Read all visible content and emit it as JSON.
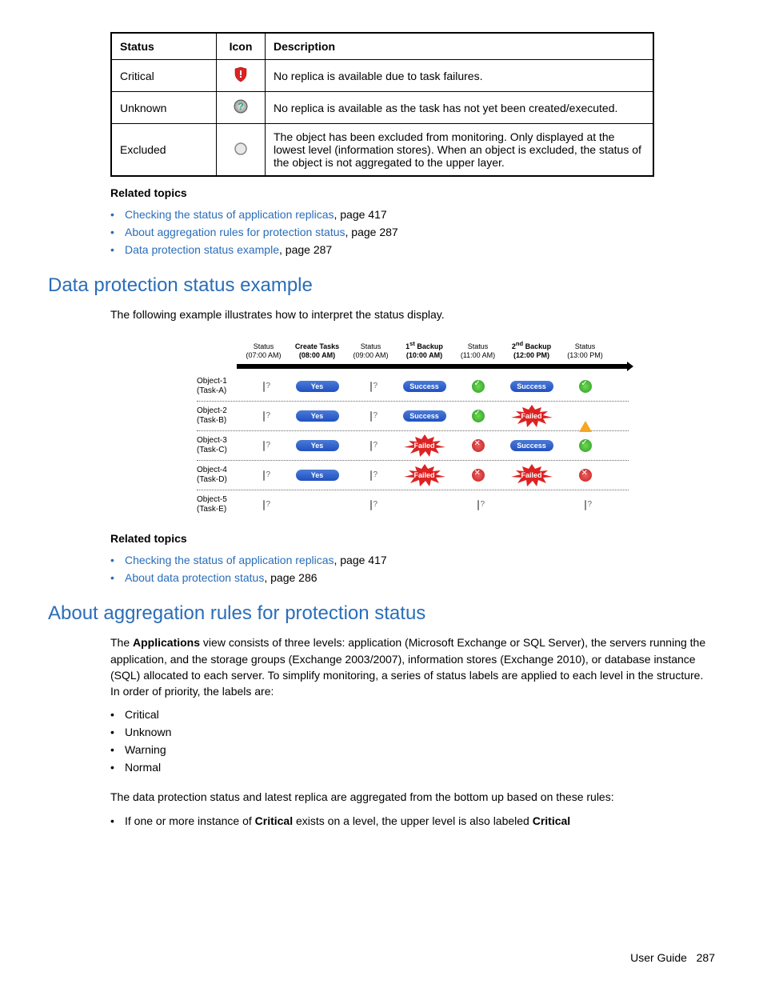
{
  "statusTable": {
    "headers": [
      "Status",
      "Icon",
      "Description"
    ],
    "rows": [
      {
        "status": "Critical",
        "icon": "critical-shield-icon",
        "desc": "No replica is available due to task failures."
      },
      {
        "status": "Unknown",
        "icon": "unknown-question-icon",
        "desc": "No replica is available as the task has not yet been created/executed."
      },
      {
        "status": "Excluded",
        "icon": "excluded-circle-icon",
        "desc": "The object has been excluded from monitoring. Only displayed at the lowest level (information stores). When an object is excluded, the status of the object is not aggregated to the upper layer."
      }
    ]
  },
  "related1": {
    "heading": "Related topics",
    "items": [
      {
        "link": "Checking the status of application replicas",
        "suffix": ", page 417"
      },
      {
        "link": "About aggregation rules for protection status",
        "suffix": ", page 287"
      },
      {
        "link": "Data protection status example",
        "suffix": ", page 287"
      }
    ]
  },
  "section1": {
    "title": "Data protection status example",
    "intro": "The following example illustrates how to interpret the status display."
  },
  "diagram": {
    "columns": [
      {
        "l1": "Status",
        "l2": "(07:00 AM)"
      },
      {
        "l1": "Create Tasks",
        "l2": "(08:00 AM)",
        "bold": true
      },
      {
        "l1": "Status",
        "l2": "(09:00 AM)"
      },
      {
        "l1": "1st Backup",
        "l2": "(10:00 AM)",
        "bold": true,
        "sup": "st"
      },
      {
        "l1": "Status",
        "l2": "(11:00 AM)"
      },
      {
        "l1": "2nd Backup",
        "l2": "(12:00 PM)",
        "bold": true,
        "sup": "nd"
      },
      {
        "l1": "Status",
        "l2": "(13:00 PM)"
      }
    ],
    "rows": [
      {
        "obj": "Object-1",
        "task": "(Task-A)",
        "cells": [
          "unk",
          "yes",
          "unk",
          "success",
          "ok",
          "success",
          "ok"
        ]
      },
      {
        "obj": "Object-2",
        "task": "(Task-B)",
        "cells": [
          "unk",
          "yes",
          "unk",
          "success",
          "ok",
          "failed",
          "warn"
        ]
      },
      {
        "obj": "Object-3",
        "task": "(Task-C)",
        "cells": [
          "unk",
          "yes",
          "unk",
          "failed",
          "err",
          "success",
          "ok"
        ]
      },
      {
        "obj": "Object-4",
        "task": "(Task-D)",
        "cells": [
          "unk",
          "yes",
          "unk",
          "failed",
          "err",
          "failed",
          "err"
        ]
      },
      {
        "obj": "Object-5",
        "task": "(Task-E)",
        "cells": [
          "unk",
          "",
          "unk",
          "",
          "unk",
          "",
          "unk"
        ]
      }
    ],
    "labels": {
      "yes": "Yes",
      "success": "Success",
      "failed": "Failed"
    }
  },
  "related2": {
    "heading": "Related topics",
    "items": [
      {
        "link": "Checking the status of application replicas",
        "suffix": ", page 417"
      },
      {
        "link": "About data protection status",
        "suffix": ", page 286"
      }
    ]
  },
  "section2": {
    "title": "About aggregation rules for protection status",
    "para_pre": "The ",
    "para_bold": "Applications",
    "para_post": " view consists of three levels: application (Microsoft Exchange or SQL Server), the servers running the application, and the storage groups (Exchange 2003/2007), information stores (Exchange 2010), or database instance (SQL) allocated to each server. To simplify monitoring, a series of status labels are applied to each level in the structure. In order of priority, the labels are:",
    "labels": [
      "Critical",
      "Unknown",
      "Warning",
      "Normal"
    ],
    "para2": "The data protection status and latest replica are aggregated from the bottom up based on these rules:",
    "rule_pre": "If one or more instance of ",
    "rule_b1": "Critical",
    "rule_mid": " exists on a level, the upper level is also labeled ",
    "rule_b2": "Critical"
  },
  "footer": {
    "label": "User Guide",
    "page": "287"
  }
}
